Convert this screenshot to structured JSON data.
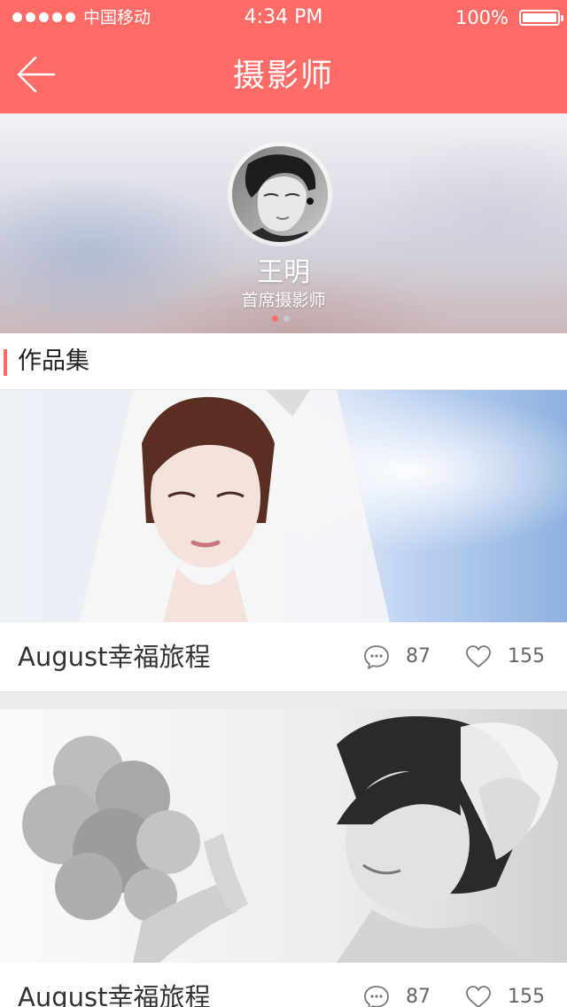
{
  "status_bar": {
    "carrier": "中国移动",
    "time": "4:34 PM",
    "battery": "100%"
  },
  "nav": {
    "title": "摄影师",
    "back_icon": "back-arrow-icon"
  },
  "profile": {
    "name": "王明",
    "role": "首席摄影师",
    "pager": {
      "pages": 2,
      "active": 1
    }
  },
  "portfolio": {
    "heading": "作品集",
    "albums": [
      {
        "title": "August幸福旅程",
        "comments": "87",
        "likes": "155",
        "comment_icon": "comment-icon",
        "like_icon": "heart-icon"
      },
      {
        "title": "August幸福旅程",
        "comments": "87",
        "likes": "155",
        "comment_icon": "comment-icon",
        "like_icon": "heart-icon"
      }
    ]
  },
  "colors": {
    "accent": "#ff6b66",
    "text": "#333333",
    "muted": "#666666",
    "divider": "#ebebeb"
  }
}
